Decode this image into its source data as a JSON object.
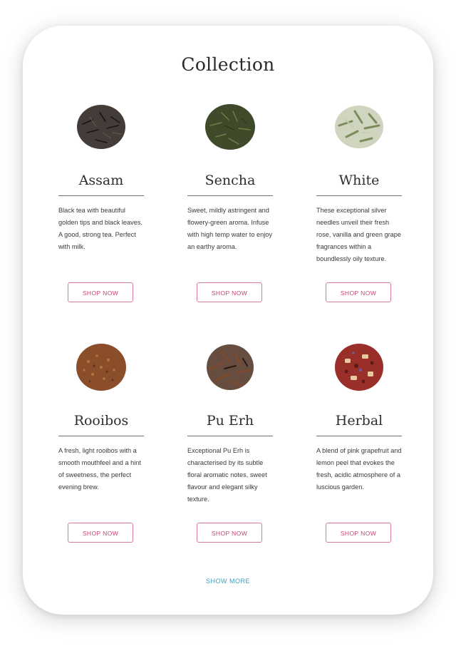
{
  "collection": {
    "title": "Collection",
    "products": [
      {
        "name": "Assam",
        "description": "Black tea with beautiful golden tips and black leaves. A good, strong tea. Perfect with milk.",
        "button_label": "SHOP NOW",
        "image_icon": "dark-tea-leaves-icon"
      },
      {
        "name": "Sencha",
        "description": "Sweet, mildly astringent and flowery-green aroma. Infuse with high temp water to enjoy an earthy aroma.",
        "button_label": "SHOP NOW",
        "image_icon": "green-tea-leaves-icon"
      },
      {
        "name": "White",
        "description": "These exceptional silver needles unveil their fresh rose, vanilla and green grape fragrances within a boundlessly oily texture.",
        "button_label": "SHOP NOW",
        "image_icon": "silver-needle-tea-icon"
      },
      {
        "name": "Rooibos",
        "description": "A fresh, light rooibos with a smooth mouthfeel and a hint of sweetness, the perfect evening brew.",
        "button_label": "SHOP NOW",
        "image_icon": "rooibos-tea-icon"
      },
      {
        "name": "Pu Erh",
        "description": "Exceptional Pu Erh is characterised by its subtle floral aromatic notes, sweet flavour and elegant silky texture.",
        "button_label": "SHOP NOW",
        "image_icon": "pu-erh-tea-icon"
      },
      {
        "name": "Herbal",
        "description": "A blend of pink grapefruit and lemon peel that evokes the fresh, acidic atmosphere of a luscious garden.",
        "button_label": "SHOP NOW",
        "image_icon": "herbal-tea-icon"
      }
    ],
    "show_more_label": "SHOW MORE"
  },
  "colors": {
    "accent_pink": "#c9466f",
    "button_border": "#d87aa0",
    "link_blue": "#3d9fbd",
    "assam": "#2f2724",
    "sencha": "#3f4a2a",
    "white_tea": "#8f9a6e",
    "rooibos": "#8a4f2a",
    "pu_erh": "#4b2e1f",
    "herbal": "#9a2f2a"
  }
}
